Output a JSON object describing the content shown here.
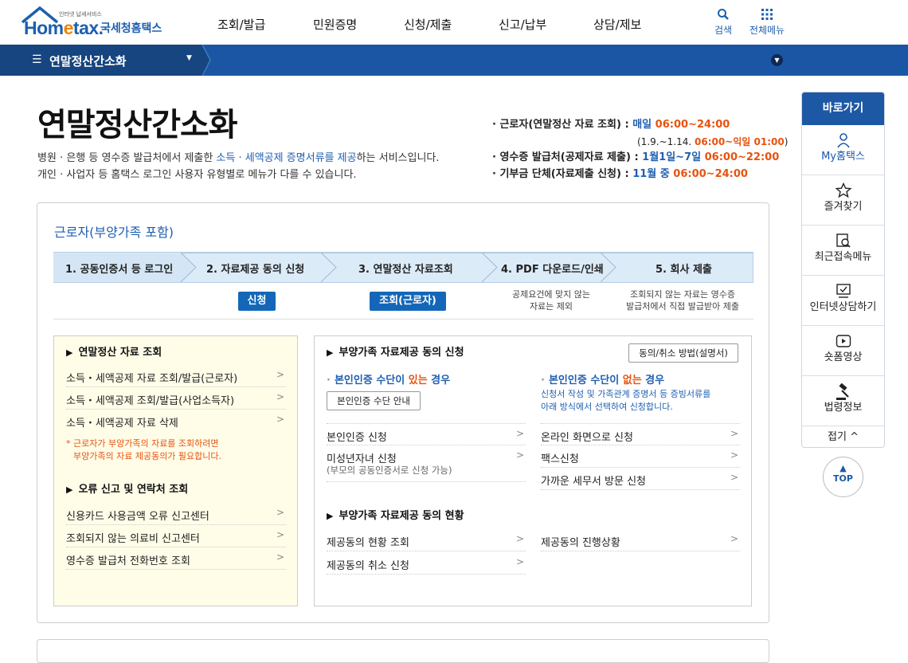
{
  "header": {
    "logo_sub": "인터넷 납세서비스",
    "logo_main_a": "Hom",
    "logo_main_e": "e",
    "logo_main_b": "tax.",
    "logo_kr": "국세청홈택스",
    "menu": [
      "조회/발급",
      "민원증명",
      "신청/제출",
      "신고/납부",
      "상담/제보"
    ],
    "search_label": "검색",
    "all_menu_label": "전체메뉴"
  },
  "subbar": {
    "title": "연말정산간소화"
  },
  "page": {
    "title": "연말정산간소화",
    "desc_line1_a": "병원 · 은행 등 영수증 발급처에서 제출한 ",
    "desc_line1_hl": "소득 · 세액공제 증명서류를 제공",
    "desc_line1_b": "하는 서비스입니다.",
    "desc_line2": "개인 · 사업자 등 홈택스 로그인 사용자 유형별로 메뉴가 다를 수 있습니다."
  },
  "service_hours": {
    "worker_label": "· 근로자(연말정산 자료 조회) : ",
    "worker_day": "매일 ",
    "worker_time": "06:00~24:00",
    "worker_note_a": "(1.9.~1.14. ",
    "worker_note_time": "06:00~익일 01:00",
    "worker_note_b": ")",
    "issuer_label": "· 영수증 발급처(공제자료 제출) : ",
    "issuer_day": "1월1일~7일 ",
    "issuer_time": "06:00~22:00",
    "donation_label": "· 기부금 단체(자료제출 신청) : ",
    "donation_day": "11월 중 ",
    "donation_time": "06:00~24:00"
  },
  "worker_box": {
    "title": "근로자(부양가족 포함)",
    "steps": [
      "1. 공동인증서 등 로그인",
      "2. 자료제공 동의 신청",
      "3. 연말정산 자료조회",
      "4. PDF 다운로드/인쇄",
      "5. 회사 제출"
    ],
    "step2_button": "신청",
    "step3_button": "조회(근로자)",
    "step4_note_1": "공제요건에 맞지 않는",
    "step4_note_2": "자료는 제외",
    "step5_note_1": "조회되지 않는 자료는 영수증",
    "step5_note_2": "발급처에서 직접 발급받아 제출"
  },
  "left_panel": {
    "section1_title": "연말정산 자료 조회",
    "section1_items": [
      "소득・세액공제 자료 조회/발급(근로자)",
      "소득・세액공제 조회/발급(사업소득자)",
      "소득・세액공제 자료 삭제"
    ],
    "warning_1": "* 근로자가 부양가족의 자료를 조회하려면",
    "warning_2": "부양가족의 자료 제공동의가 필요합니다.",
    "section2_title": "오류 신고 및 연락처 조회",
    "section2_items": [
      "신용카드 사용금액 오류 신고센터",
      "조회되지 않는 의료비 신고센터",
      "영수증 발급처 전화번호 조회"
    ]
  },
  "right_panel": {
    "section1_title": "부양가족 자료제공 동의 신청",
    "guide_button": "동의/취소 방법(설명서)",
    "has_auth_a": "본인인증 수단이 ",
    "has_auth_red": "있는",
    "has_auth_b": " 경우",
    "auth_guide_button": "본인인증 수단 안내",
    "no_auth_a": "본인인증 수단이 ",
    "no_auth_red": "없는",
    "no_auth_b": " 경우",
    "no_auth_desc_1": "신청서 작성 및 가족관계 증명서 등 증빙서류를",
    "no_auth_desc_2": "아래 방식에서 선택하여 신청합니다.",
    "left_items": [
      "본인인증 신청",
      "미성년자녀 신청"
    ],
    "minor_sub": "(부모의 공동인증서로 신청 가능)",
    "right_items": [
      "온라인 화면으로 신청",
      "팩스신청",
      "가까운 세무서 방문 신청"
    ],
    "section2_title": "부양가족 자료제공 동의 현황",
    "status_left": [
      "제공동의 현황 조회",
      "제공동의 취소 신청"
    ],
    "status_right": [
      "제공동의 진행상황"
    ]
  },
  "quick_menu": {
    "title": "바로가기",
    "items": [
      "My홈택스",
      "즐겨찾기",
      "최근접속메뉴",
      "인터넷상담하기",
      "숏폼영상",
      "법령정보"
    ],
    "close_label": "접기 ^",
    "top_label": "TOP"
  },
  "colors": {
    "primary": "#1b56a5",
    "accent_orange": "#e8520f",
    "step_bg": "#dcebf8"
  }
}
